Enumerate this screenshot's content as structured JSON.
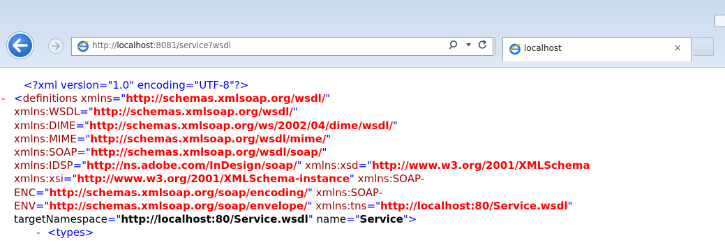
{
  "browser": {
    "address": {
      "prefix": "http://",
      "host": "localhost",
      "suffix": ":8081/service?wsdl",
      "search_icon": "search-icon",
      "dropdown_icon": "dropdown-arrow-icon",
      "refresh_icon": "refresh-icon"
    },
    "tab": {
      "title": "localhost",
      "close": "×"
    },
    "colors": {
      "back_button": "#2f74cf",
      "chrome": "#d3e0f1"
    }
  },
  "xml": {
    "prolog": "<?xml version=\"1.0\" encoding=\"UTF-8\"?>",
    "collapse_marker": "-",
    "open_bracket": "<",
    "close_bracket": ">",
    "quote": "\"",
    "eq_quote": "=\"",
    "root_tag": "definitions",
    "attrs": [
      {
        "name": "xmlns",
        "value": "http://schemas.xmlsoap.org/wsdl/"
      },
      {
        "name": "xmlns:WSDL",
        "value": "http://schemas.xmlsoap.org/wsdl/"
      },
      {
        "name": "xmlns:DIME",
        "value": "http://schemas.xmlsoap.org/ws/2002/04/dime/wsdl/"
      },
      {
        "name": "xmlns:MIME",
        "value": "http://schemas.xmlsoap.org/wsdl/mime/"
      },
      {
        "name": "xmlns:SOAP",
        "value": "http://schemas.xmlsoap.org/wsdl/soap/"
      },
      {
        "name": "xmlns:IDSP",
        "value": "http://ns.adobe.com/InDesign/soap/"
      },
      {
        "name": "xmlns:xsd",
        "value": "http://www.w3.org/2001/XMLSchema"
      },
      {
        "name": "xmlns:xsi",
        "value": "http://www.w3.org/2001/XMLSchema-instance"
      },
      {
        "name_part1": "xmlns:SOAP-",
        "name_part2": "ENC",
        "value": "http://schemas.xmlsoap.org/soap/encoding/"
      },
      {
        "name_part1": "xmlns:SOAP-",
        "name_part2": "ENV",
        "value": "http://schemas.xmlsoap.org/soap/envelope/"
      },
      {
        "name": "xmlns:tns",
        "value": "http://localhost:80/Service.wsdl"
      },
      {
        "name": "targetNamespace",
        "value": "http://localhost:80/Service.wsdl"
      },
      {
        "name": "name",
        "value": "Service"
      }
    ],
    "child_tag": "<types>"
  }
}
